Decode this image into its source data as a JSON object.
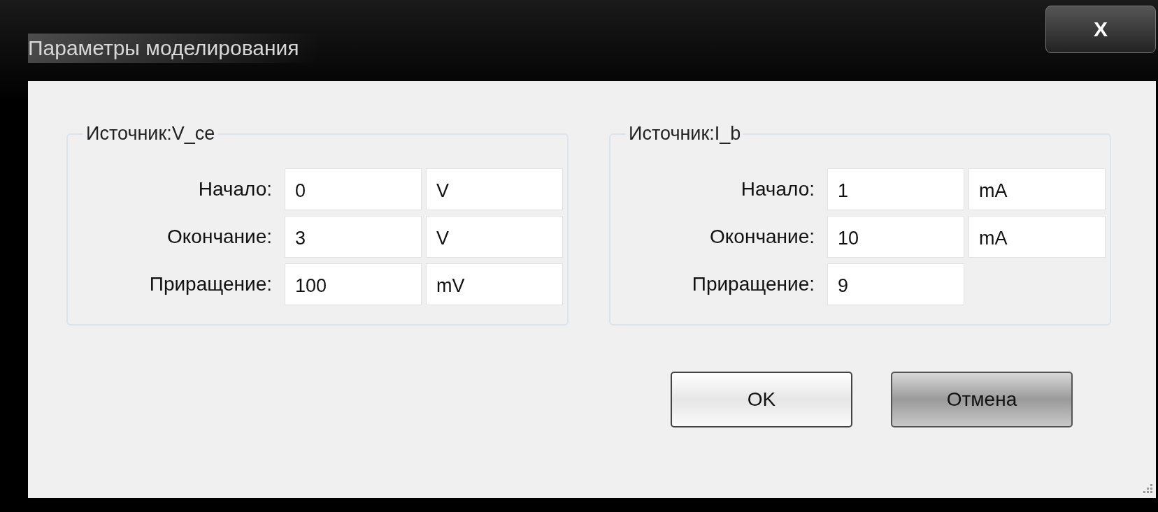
{
  "window": {
    "title": "Параметры моделирования",
    "close": "X"
  },
  "groups": [
    {
      "title": "Источник:V_ce",
      "rows": [
        {
          "label": "Начало:",
          "value": "0",
          "unit": "V"
        },
        {
          "label": "Окончание:",
          "value": "3",
          "unit": "V"
        },
        {
          "label": "Приращение:",
          "value": "100",
          "unit": "mV"
        }
      ]
    },
    {
      "title": "Источник:I_b",
      "rows": [
        {
          "label": "Начало:",
          "value": "1",
          "unit": "mA"
        },
        {
          "label": "Окончание:",
          "value": "10",
          "unit": "mA"
        },
        {
          "label": "Приращение:",
          "value": "9"
        }
      ]
    }
  ],
  "buttons": [
    {
      "label": "OK",
      "default": true
    },
    {
      "label": "Отмена",
      "default": false
    }
  ]
}
